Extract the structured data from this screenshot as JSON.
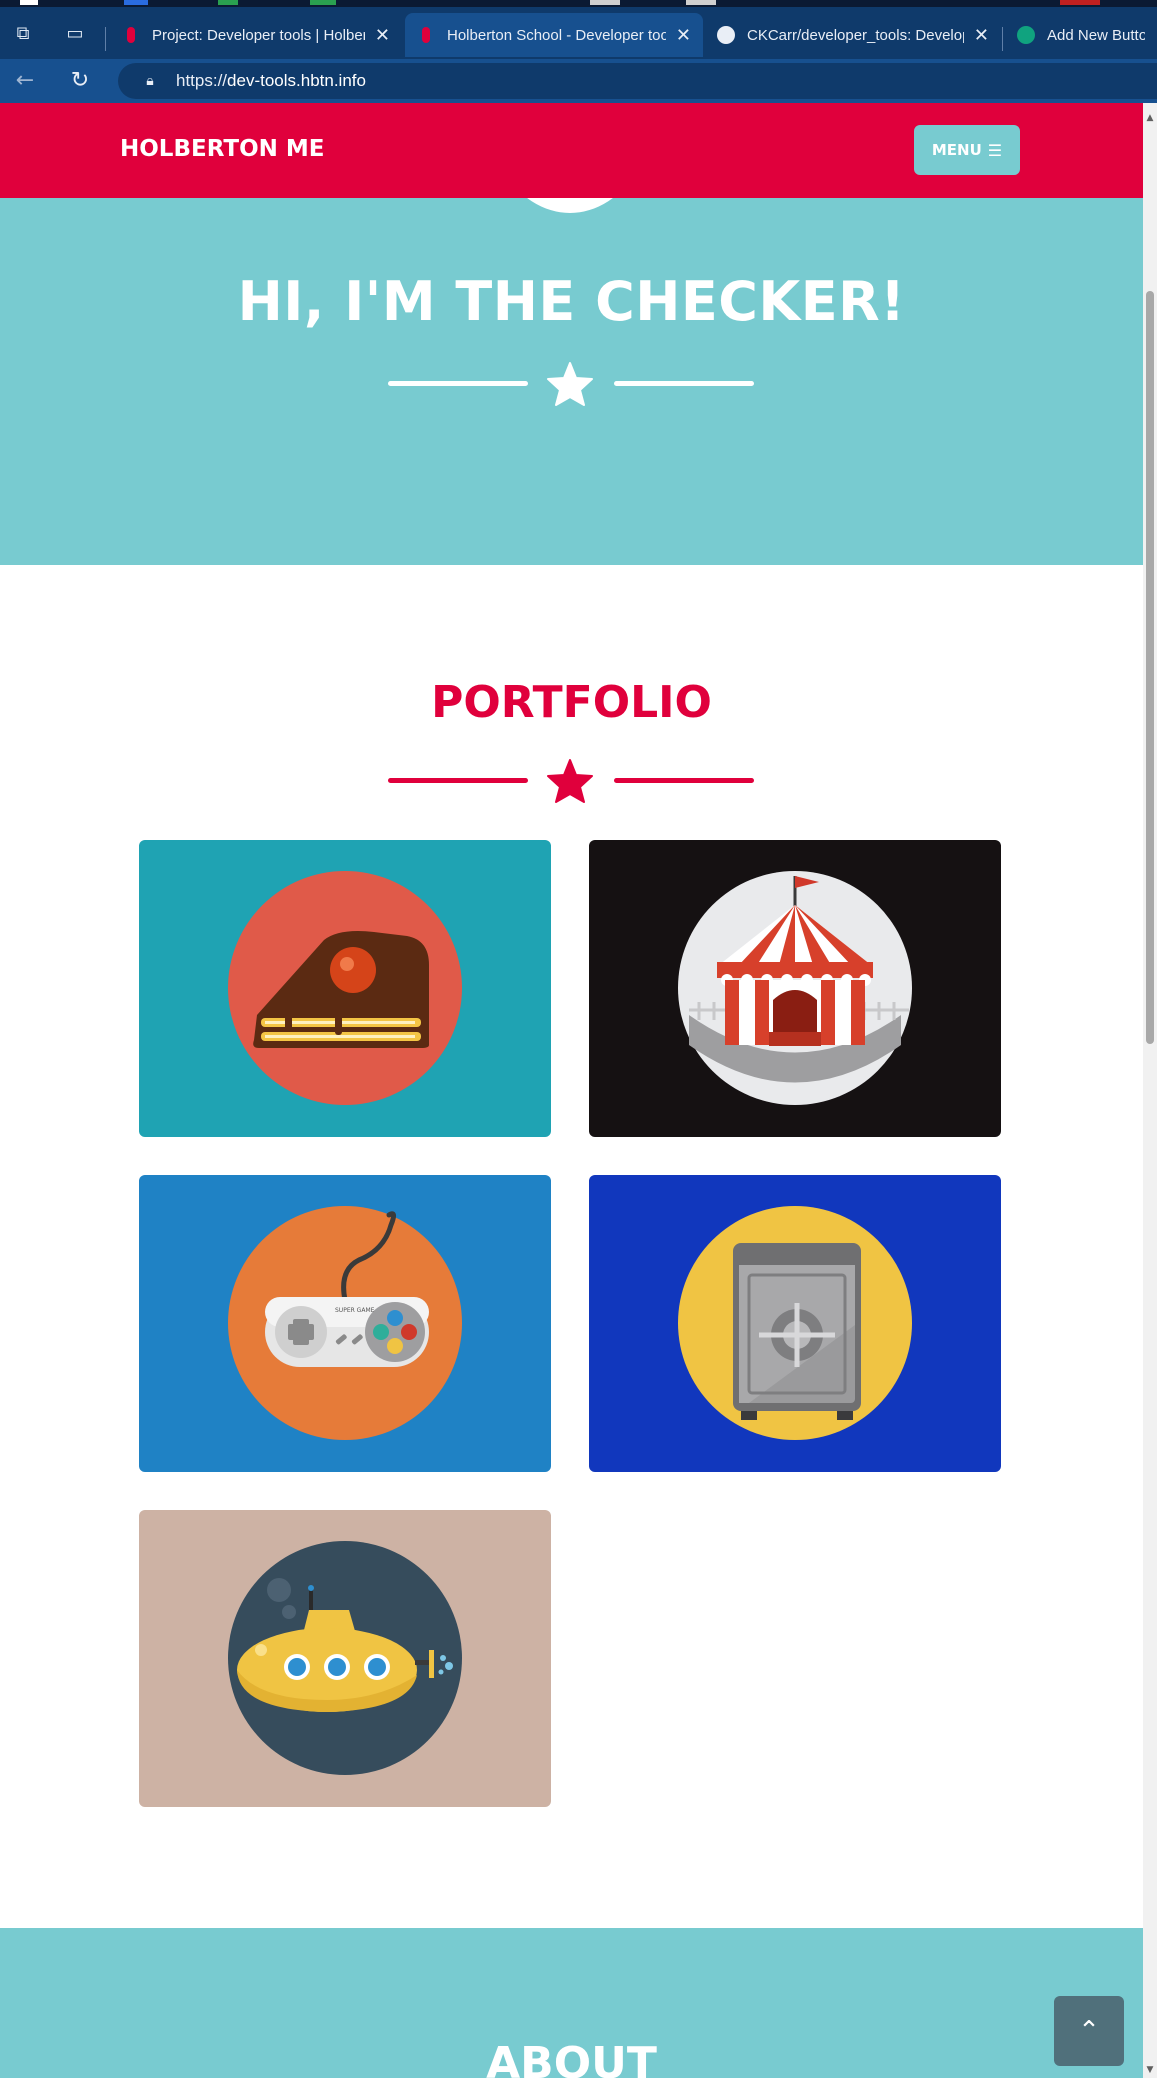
{
  "browser": {
    "tabs": [
      {
        "title": "Project: Developer tools | Holberton",
        "active": false
      },
      {
        "title": "Holberton School - Developer tools",
        "active": true
      },
      {
        "title": "CKCarr/developer_tools: Developer",
        "active": false
      },
      {
        "title": "Add New Button",
        "active": false
      }
    ],
    "url_scheme": "https://",
    "url_host": "dev-tools.hbtn.info"
  },
  "navbar": {
    "brand": "HOLBERTON ME",
    "menu_label": "MENU",
    "menu_icon": "bars-icon"
  },
  "hero": {
    "title": "HI, I'M THE CHECKER!"
  },
  "portfolio": {
    "title": "PORTFOLIO",
    "items": [
      {
        "icon": "cake-icon",
        "background": "#1fa3b3",
        "circle": "#e05a49"
      },
      {
        "icon": "circus-tent-icon",
        "background": "#151112",
        "circle": "#e9eaec"
      },
      {
        "icon": "game-controller-icon",
        "background": "#1f82c5",
        "circle": "#e67b39"
      },
      {
        "icon": "safe-icon",
        "background": "#1137bd",
        "circle": "#f0c443"
      },
      {
        "icon": "submarine-icon",
        "background": "#cdb2a4",
        "circle": "#364c5c"
      }
    ],
    "controller_brand": "SUPER GAME"
  },
  "about": {
    "title": "ABOUT"
  },
  "colors": {
    "primary": "#e0003c",
    "teal": "#78cbd0",
    "white": "#ffffff"
  }
}
